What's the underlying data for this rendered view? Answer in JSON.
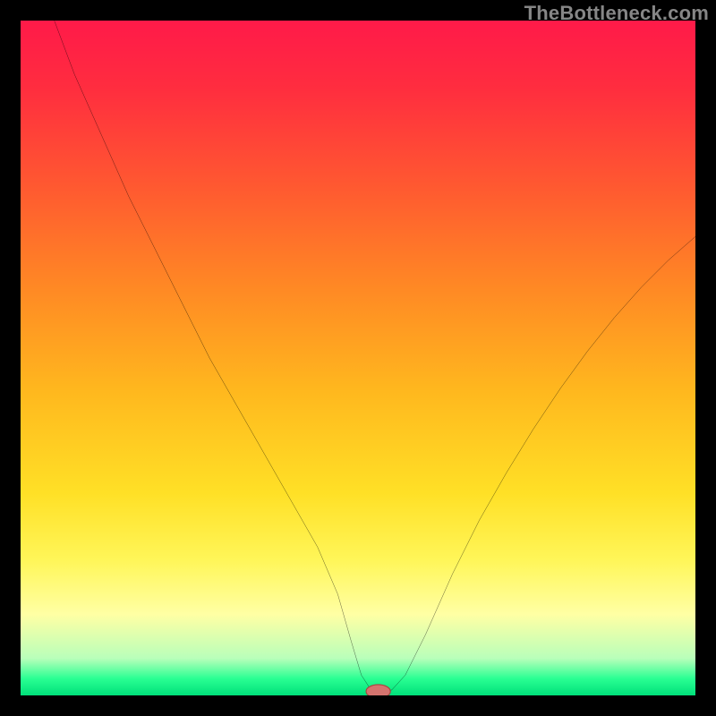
{
  "watermark": "TheBottleneck.com",
  "chart_data": {
    "type": "line",
    "title": "",
    "xlabel": "",
    "ylabel": "",
    "xlim": [
      0,
      100
    ],
    "ylim": [
      0,
      100
    ],
    "background_gradient": {
      "stops": [
        {
          "offset": 0.0,
          "color": "#ff1a49"
        },
        {
          "offset": 0.1,
          "color": "#ff2d3f"
        },
        {
          "offset": 0.25,
          "color": "#ff5a30"
        },
        {
          "offset": 0.4,
          "color": "#ff8a24"
        },
        {
          "offset": 0.55,
          "color": "#ffb81e"
        },
        {
          "offset": 0.7,
          "color": "#ffe026"
        },
        {
          "offset": 0.8,
          "color": "#fff659"
        },
        {
          "offset": 0.88,
          "color": "#ffffa4"
        },
        {
          "offset": 0.945,
          "color": "#b9ffba"
        },
        {
          "offset": 0.975,
          "color": "#2aff93"
        },
        {
          "offset": 1.0,
          "color": "#00e07a"
        }
      ]
    },
    "series": [
      {
        "name": "bottleneck-curve",
        "color": "#000000",
        "x": [
          5,
          8,
          12,
          16,
          20,
          24,
          28,
          32,
          36,
          40,
          44,
          47,
          49,
          50.5,
          52,
          53.5,
          55,
          57,
          60,
          64,
          68,
          72,
          76,
          80,
          84,
          88,
          92,
          96,
          100
        ],
        "y": [
          100,
          92,
          83,
          74,
          66,
          58,
          50,
          43,
          36,
          29,
          22,
          15,
          8,
          3,
          0.7,
          0.6,
          0.8,
          3,
          9,
          18,
          26,
          33,
          39.5,
          45.5,
          51,
          56,
          60.5,
          64.5,
          68
        ]
      }
    ],
    "marker": {
      "name": "optimal-point",
      "x": 53.0,
      "y": 0.6,
      "rx": 1.8,
      "ry": 1.0,
      "fill": "#d4736e",
      "stroke": "#a8433f"
    }
  }
}
